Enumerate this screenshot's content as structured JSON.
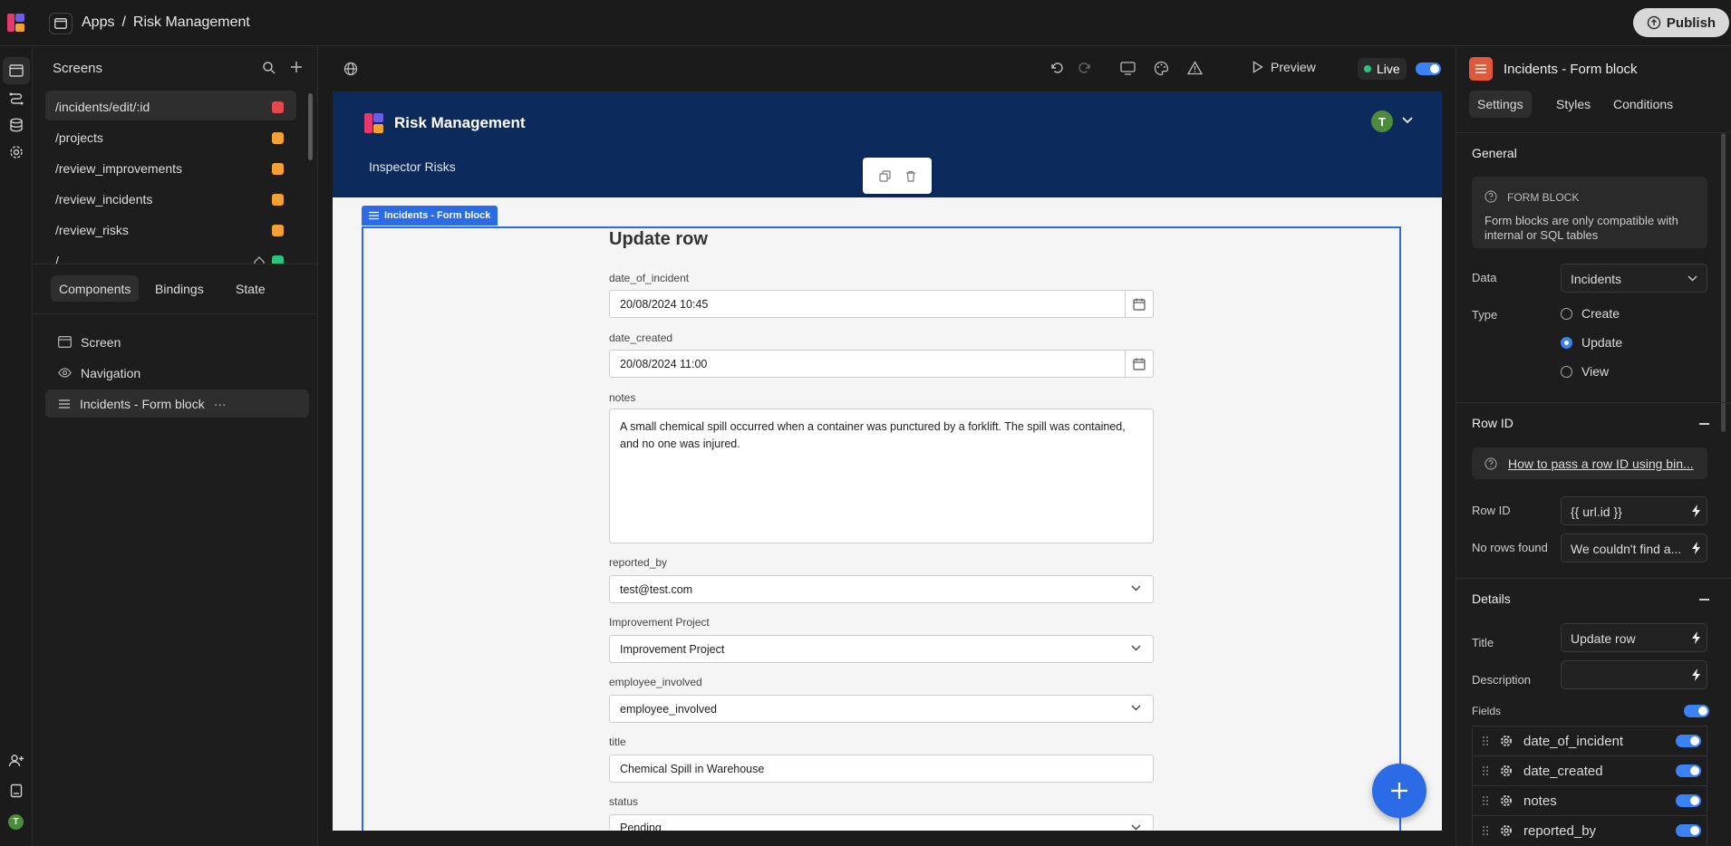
{
  "topbar": {
    "crumb_apps": "Apps",
    "crumb_sep": "/",
    "crumb_app": "Risk Management",
    "publish_label": "Publish"
  },
  "screens": {
    "title": "Screens",
    "items": [
      {
        "label": "/incidents/edit/:id",
        "color": "#e5484d"
      },
      {
        "label": "/projects",
        "color": "#f5a033"
      },
      {
        "label": "/review_improvements",
        "color": "#f5a033"
      },
      {
        "label": "/review_incidents",
        "color": "#f5a033"
      },
      {
        "label": "/review_risks",
        "color": "#f5a033"
      },
      {
        "label": "/",
        "color": "#2ec27e"
      }
    ]
  },
  "component_tabs": {
    "components": "Components",
    "bindings": "Bindings",
    "state": "State"
  },
  "tree": {
    "screen": "Screen",
    "navigation": "Navigation",
    "form_block": "Incidents - Form block",
    "more": "···"
  },
  "canvas": {
    "preview_label": "Preview",
    "live_label": "Live"
  },
  "app": {
    "brand": "Risk Management",
    "nav_link": "Inspector Risks",
    "avatar": "T",
    "block_label": "Incidents - Form block",
    "form_title": "Update row",
    "fields": {
      "date_of_incident": {
        "label": "date_of_incident",
        "value": "20/08/2024 10:45"
      },
      "date_created": {
        "label": "date_created",
        "value": "20/08/2024 11:00"
      },
      "notes": {
        "label": "notes",
        "value": "A small chemical spill occurred when a container was punctured by a forklift. The spill was contained, and no one was injured."
      },
      "reported_by": {
        "label": "reported_by",
        "value": "test@test.com"
      },
      "improvement_project": {
        "label": "Improvement Project",
        "value": "Improvement Project"
      },
      "employee_involved": {
        "label": "employee_involved",
        "value": "employee_involved"
      },
      "title": {
        "label": "title",
        "value": "Chemical Spill in Warehouse"
      },
      "status": {
        "label": "status",
        "value": "Pending"
      }
    }
  },
  "rpanel": {
    "title": "Incidents - Form block",
    "tabs": {
      "settings": "Settings",
      "styles": "Styles",
      "conditions": "Conditions"
    },
    "general": "General",
    "info_title": "FORM BLOCK",
    "info_text": "Form blocks are only compatible with internal or SQL tables",
    "data_label": "Data",
    "data_value": "Incidents",
    "type_label": "Type",
    "type_options": {
      "create": "Create",
      "update": "Update",
      "view": "View"
    },
    "row_id_section": "Row ID",
    "help_link": "How to pass a row ID using bin...",
    "row_id_label": "Row ID",
    "row_id_value": "{{ url.id }}",
    "no_rows_label": "No rows found",
    "no_rows_value": "We couldn't find a...",
    "details_section": "Details",
    "title_label": "Title",
    "title_value": "Update row",
    "description_label": "Description",
    "description_value": "",
    "fields_label": "Fields",
    "fields": [
      "date_of_incident",
      "date_created",
      "notes",
      "reported_by"
    ]
  }
}
